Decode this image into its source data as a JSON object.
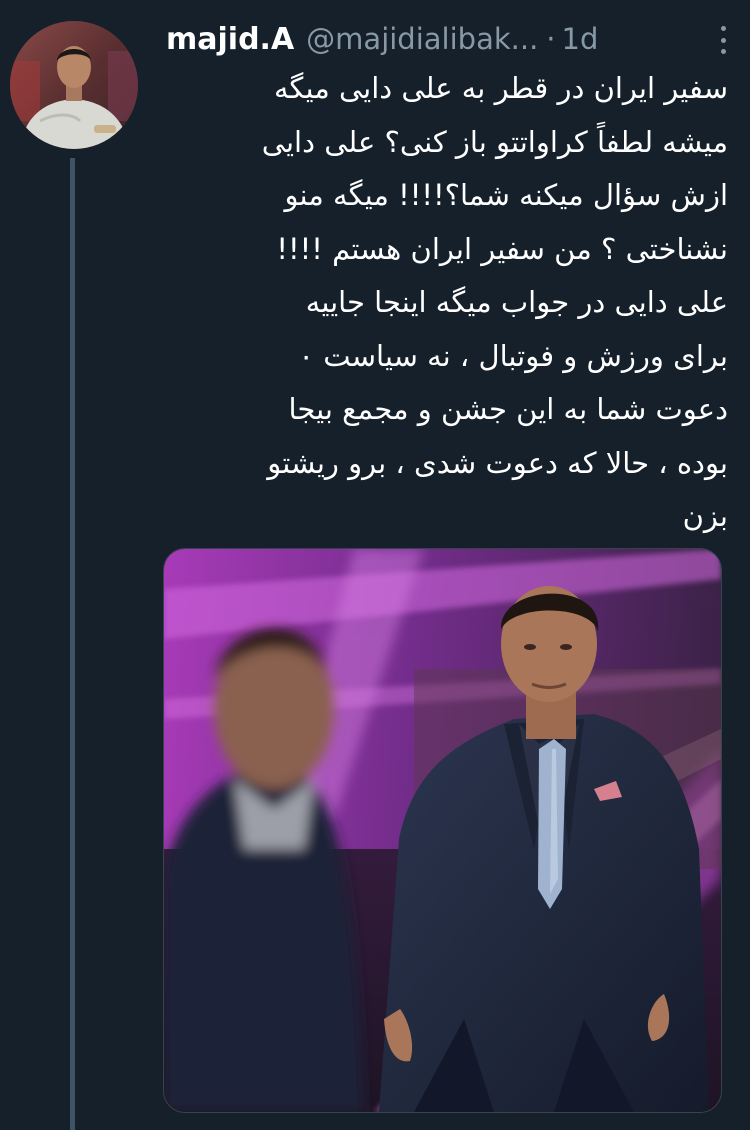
{
  "author": {
    "display_name": "majid.A",
    "handle": "@majidialibak...",
    "separator": "·",
    "time": "1d"
  },
  "tweet": {
    "lines": [
      "سفیر ایران در قطر به علی دایی میگه",
      "میشه لطفاً کراواتتو باز کنی؟ علی دایی",
      "ازش سؤال میکنه شما؟!!!! میگه منو",
      "نشناختی ؟ من سفیر ایران هستم !!!!",
      "علی دایی در جواب میگه اینجا جاییه",
      "برای ورزش و فوتبال ، نه سیاست ٠",
      "دعوت شما به این جشن و مجمع بیجا",
      "بوده ، حالا که دعوت شدی ، برو ریشتو",
      "بزن"
    ]
  },
  "icons": {
    "more": "more-vertical-icon"
  },
  "colors": {
    "background": "#15202b",
    "text": "#ffffff",
    "secondary_text": "#8899a6",
    "thread_line": "#3d5466",
    "media_accent": "#c23bd6"
  }
}
